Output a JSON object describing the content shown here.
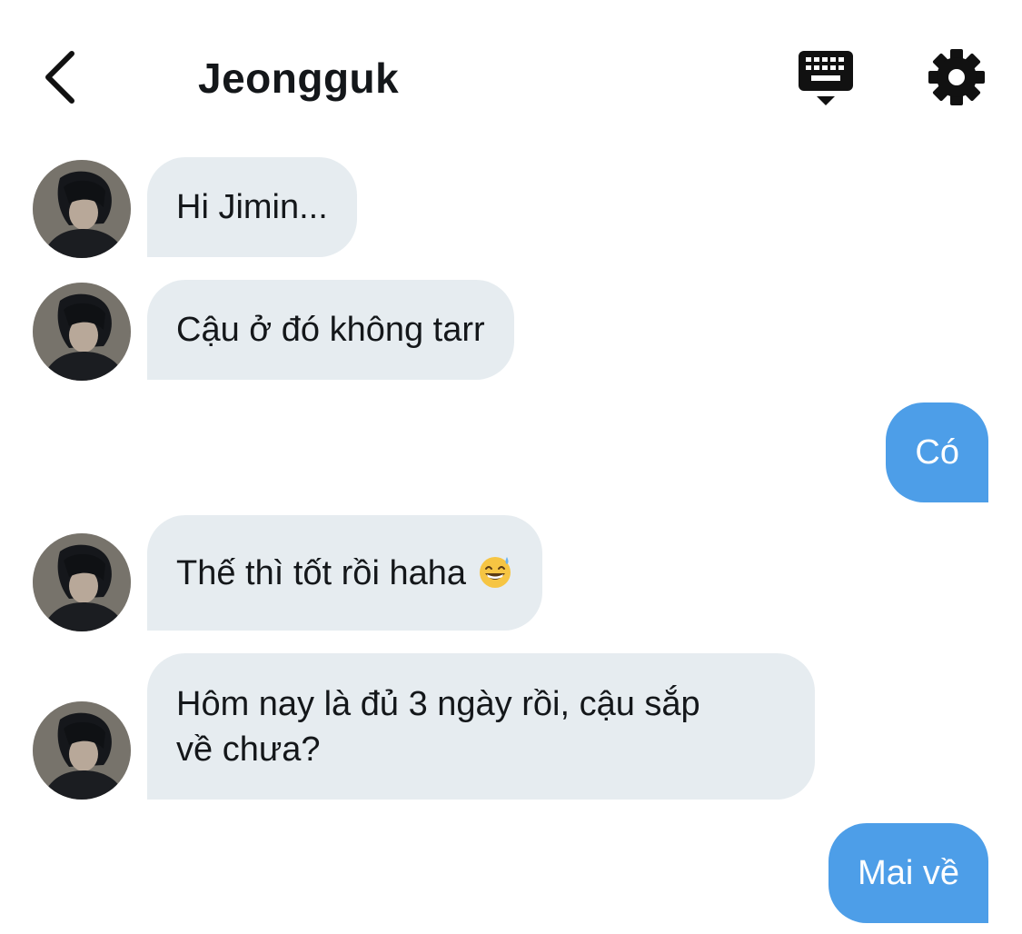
{
  "header": {
    "title": "Jeongguk",
    "back_icon": "chevron-left-icon",
    "keyboard_icon": "keyboard-icon",
    "settings_icon": "gear-icon"
  },
  "colors": {
    "incoming_bubble": "#e6ecf0",
    "outgoing_bubble": "#4d9ee8",
    "text": "#14171a"
  },
  "messages": [
    {
      "direction": "in",
      "text": "Hi Jimin..."
    },
    {
      "direction": "in",
      "text": "Cậu ở đó không tarr"
    },
    {
      "direction": "out",
      "text": "Có"
    },
    {
      "direction": "in",
      "text": "Thế thì tốt rồi haha",
      "emoji": "grinning-sweat-emoji"
    },
    {
      "direction": "in",
      "text": "Hôm nay là đủ 3 ngày rồi, cậu sắp\nvề chưa?"
    },
    {
      "direction": "out",
      "text": "Mai về"
    }
  ]
}
